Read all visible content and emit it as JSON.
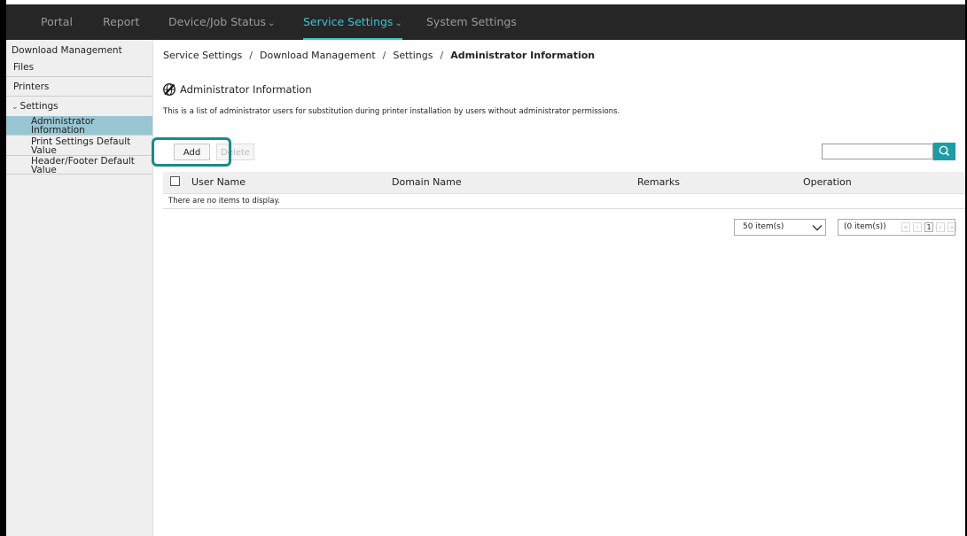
{
  "nav": {
    "tabs": [
      {
        "label": "Portal"
      },
      {
        "label": "Report"
      },
      {
        "label": "Device/Job Status"
      },
      {
        "label": "Service Settings",
        "active": true
      },
      {
        "label": "System Settings"
      }
    ],
    "accent_color": "#3cc1d6",
    "bar_color": "#262626"
  },
  "sidebar": {
    "heading": "Download Management",
    "items": [
      {
        "label": "Files"
      },
      {
        "label": "Printers"
      },
      {
        "label": "Settings",
        "expanded": true,
        "icon": "chevron-down-icon"
      },
      {
        "label_line1": "Administrator",
        "label_line2": "Information",
        "selected": true
      },
      {
        "label_line1": "Print Settings Default",
        "label_line2": "Value"
      },
      {
        "label_line1": "Header/Footer Default",
        "label_line2": "Value"
      }
    ],
    "selected_color": "#98c6d2"
  },
  "breadcrumb": {
    "items": [
      "Service Settings",
      "Download Management",
      "Settings"
    ],
    "current": "Administrator Information",
    "separator": "/"
  },
  "page": {
    "title": "Administrator Information",
    "title_icon": "globe-slash-icon",
    "description": "This is a list of administrator users for substitution during printer installation by users without administrator permissions."
  },
  "toolbar": {
    "add_label": "Add",
    "delete_label": "Delete",
    "search_value": "",
    "search_icon": "search-icon",
    "search_button_color": "#1a9da6"
  },
  "table": {
    "columns": [
      "User Name",
      "Domain Name",
      "Remarks",
      "Operation"
    ],
    "rows": [],
    "empty_message": "There are no items to display."
  },
  "pagination": {
    "per_page": "50 item(s)",
    "total": "(0 item(s))",
    "current_page": "1",
    "first_symbol": "«",
    "prev_symbol": "‹",
    "next_symbol": "›",
    "last_symbol": "»"
  }
}
